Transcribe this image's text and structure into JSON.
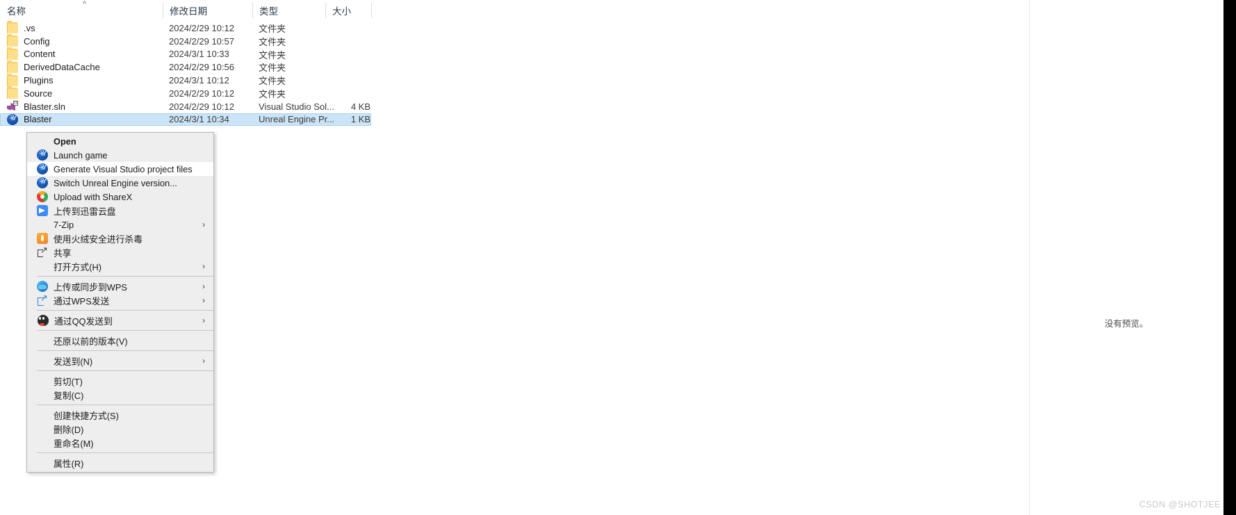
{
  "explorer": {
    "columns": [
      {
        "label": "名称",
        "key": "name"
      },
      {
        "label": "修改日期",
        "key": "date"
      },
      {
        "label": "类型",
        "key": "type"
      },
      {
        "label": "大小",
        "key": "size"
      }
    ],
    "sort_indicator": "^",
    "rows": [
      {
        "name": ".vs",
        "date": "2024/2/29 10:12",
        "type": "文件夹",
        "size": "",
        "icon": "folder-icon",
        "selected": false
      },
      {
        "name": "Config",
        "date": "2024/2/29 10:57",
        "type": "文件夹",
        "size": "",
        "icon": "folder-icon",
        "selected": false
      },
      {
        "name": "Content",
        "date": "2024/3/1 10:33",
        "type": "文件夹",
        "size": "",
        "icon": "folder-icon",
        "selected": false
      },
      {
        "name": "DerivedDataCache",
        "date": "2024/2/29 10:56",
        "type": "文件夹",
        "size": "",
        "icon": "folder-icon",
        "selected": false
      },
      {
        "name": "Plugins",
        "date": "2024/3/1 10:12",
        "type": "文件夹",
        "size": "",
        "icon": "folder-icon",
        "selected": false
      },
      {
        "name": "Source",
        "date": "2024/2/29 10:12",
        "type": "文件夹",
        "size": "",
        "icon": "folder-icon",
        "selected": false
      },
      {
        "name": "Blaster.sln",
        "date": "2024/2/29 10:12",
        "type": "Visual Studio Sol...",
        "size": "4 KB",
        "icon": "visual-studio-icon",
        "selected": false
      },
      {
        "name": "Blaster",
        "date": "2024/3/1 10:34",
        "type": "Unreal Engine Pr...",
        "size": "1 KB",
        "icon": "unreal-engine-icon",
        "selected": true
      }
    ]
  },
  "context_menu": {
    "items": [
      {
        "label": "Open",
        "icon": "",
        "bold": true,
        "chevron": false,
        "hover": false
      },
      {
        "label": "Launch game",
        "icon": "unreal-engine-icon",
        "bold": false,
        "chevron": false,
        "hover": false
      },
      {
        "label": "Generate Visual Studio project files",
        "icon": "unreal-engine-icon",
        "bold": false,
        "chevron": false,
        "hover": true
      },
      {
        "label": "Switch Unreal Engine version...",
        "icon": "unreal-engine-icon",
        "bold": false,
        "chevron": false,
        "hover": false
      },
      {
        "label": "Upload with ShareX",
        "icon": "sharex-icon",
        "bold": false,
        "chevron": false,
        "hover": false
      },
      {
        "label": "上传到迅雷云盘",
        "icon": "thunder-icon",
        "bold": false,
        "chevron": false,
        "hover": false
      },
      {
        "label": "7-Zip",
        "icon": "",
        "bold": false,
        "chevron": true,
        "hover": false
      },
      {
        "label": "使用火绒安全进行杀毒",
        "icon": "huorong-icon",
        "bold": false,
        "chevron": false,
        "hover": false
      },
      {
        "label": "共享",
        "icon": "share-icon",
        "bold": false,
        "chevron": false,
        "hover": false
      },
      {
        "label": "打开方式(H)",
        "icon": "",
        "bold": false,
        "chevron": true,
        "hover": false
      },
      {
        "separator": true
      },
      {
        "label": "上传或同步到WPS",
        "icon": "wps-cloud-icon",
        "bold": false,
        "chevron": true,
        "hover": false
      },
      {
        "label": "通过WPS发送",
        "icon": "wps-send-icon",
        "bold": false,
        "chevron": true,
        "hover": false
      },
      {
        "separator": true
      },
      {
        "label": "通过QQ发送到",
        "icon": "qq-icon",
        "bold": false,
        "chevron": true,
        "hover": false
      },
      {
        "separator": true
      },
      {
        "label": "还原以前的版本(V)",
        "icon": "",
        "bold": false,
        "chevron": false,
        "hover": false
      },
      {
        "separator": true
      },
      {
        "label": "发送到(N)",
        "icon": "",
        "bold": false,
        "chevron": true,
        "hover": false
      },
      {
        "separator": true
      },
      {
        "label": "剪切(T)",
        "icon": "",
        "bold": false,
        "chevron": false,
        "hover": false
      },
      {
        "label": "复制(C)",
        "icon": "",
        "bold": false,
        "chevron": false,
        "hover": false
      },
      {
        "separator": true
      },
      {
        "label": "创建快捷方式(S)",
        "icon": "",
        "bold": false,
        "chevron": false,
        "hover": false
      },
      {
        "label": "删除(D)",
        "icon": "",
        "bold": false,
        "chevron": false,
        "hover": false
      },
      {
        "label": "重命名(M)",
        "icon": "",
        "bold": false,
        "chevron": false,
        "hover": false
      },
      {
        "separator": true
      },
      {
        "label": "属性(R)",
        "icon": "",
        "bold": false,
        "chevron": false,
        "hover": false
      }
    ],
    "chevron_glyph": "›"
  },
  "preview": {
    "message": "没有预览。"
  },
  "watermark": {
    "text": "CSDN @SHOTJEE"
  },
  "colors": {
    "selection": "#cce4f7",
    "menu_background": "#eeeeee",
    "menu_hover": "#ffffff",
    "folder": "#fcd06a",
    "unreal_blue": "#1356ae"
  }
}
